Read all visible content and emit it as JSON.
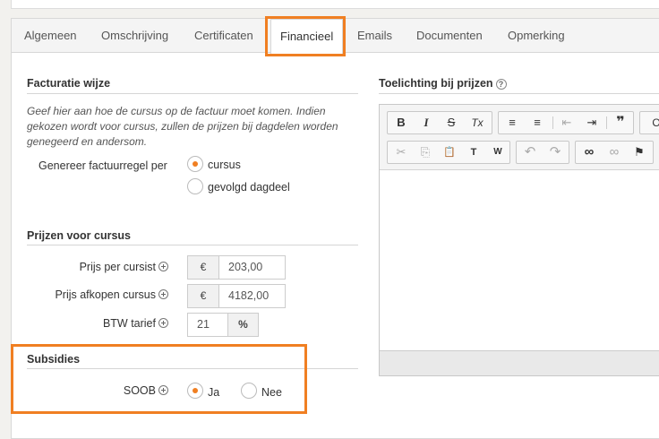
{
  "tabs": [
    {
      "label": "Algemeen"
    },
    {
      "label": "Omschrijving"
    },
    {
      "label": "Certificaten"
    },
    {
      "label": "Financieel"
    },
    {
      "label": "Emails"
    },
    {
      "label": "Documenten"
    },
    {
      "label": "Opmerking"
    }
  ],
  "active_tab": "Financieel",
  "facturatie": {
    "title": "Facturatie wijze",
    "help": "Geef hier aan hoe de cursus op de factuur moet komen. Indien gekozen wordt voor cursus, zullen de prijzen bij dagdelen worden genegeerd en andersom.",
    "field_label": "Genereer factuurregel per",
    "options": [
      "cursus",
      "gevolgd dagdeel"
    ],
    "selected": "cursus"
  },
  "prijzen": {
    "title": "Prijzen voor cursus",
    "prijs_per_cursist": {
      "label": "Prijs per cursist",
      "currency": "€",
      "value": "203,00"
    },
    "prijs_afkopen": {
      "label": "Prijs afkopen cursus",
      "currency": "€",
      "value": "4182,00"
    },
    "btw": {
      "label": "BTW tarief",
      "value": "21",
      "unit": "%"
    }
  },
  "subsidies": {
    "title": "Subsidies",
    "soob_label": "SOOB",
    "options": [
      "Ja",
      "Nee"
    ],
    "selected": "Ja"
  },
  "toelichting": {
    "title": "Toelichting bij prijzen",
    "help_icon": "question-circle-icon",
    "content": ""
  },
  "editor_toolbar": {
    "row1": [
      {
        "icon": "bold-icon",
        "glyph": "B"
      },
      {
        "icon": "italic-icon",
        "glyph": "I"
      },
      {
        "icon": "strikethrough-icon",
        "glyph": "S"
      },
      {
        "icon": "remove-format-icon",
        "glyph": "Tx"
      },
      {
        "icon": "numbered-list-icon",
        "glyph": "≡"
      },
      {
        "icon": "bulleted-list-icon",
        "glyph": "≡"
      },
      {
        "icon": "outdent-icon",
        "glyph": "⇤"
      },
      {
        "icon": "indent-icon",
        "glyph": "⇥"
      },
      {
        "icon": "blockquote-icon",
        "glyph": "❞"
      },
      {
        "icon": "format-dropdown-icon",
        "glyph": "O"
      }
    ],
    "row2": [
      {
        "icon": "cut-icon",
        "glyph": "✂"
      },
      {
        "icon": "copy-icon",
        "glyph": "⎘"
      },
      {
        "icon": "paste-icon",
        "glyph": "📋"
      },
      {
        "icon": "paste-text-icon",
        "glyph": "T"
      },
      {
        "icon": "paste-word-icon",
        "glyph": "W"
      },
      {
        "icon": "undo-icon",
        "glyph": "↶"
      },
      {
        "icon": "redo-icon",
        "glyph": "↷"
      },
      {
        "icon": "link-icon",
        "glyph": "∞"
      },
      {
        "icon": "unlink-icon",
        "glyph": "∞"
      },
      {
        "icon": "anchor-flag-icon",
        "glyph": "⚑"
      }
    ]
  },
  "colors": {
    "accent": "#f07f22",
    "highlight": "#f07f22"
  }
}
